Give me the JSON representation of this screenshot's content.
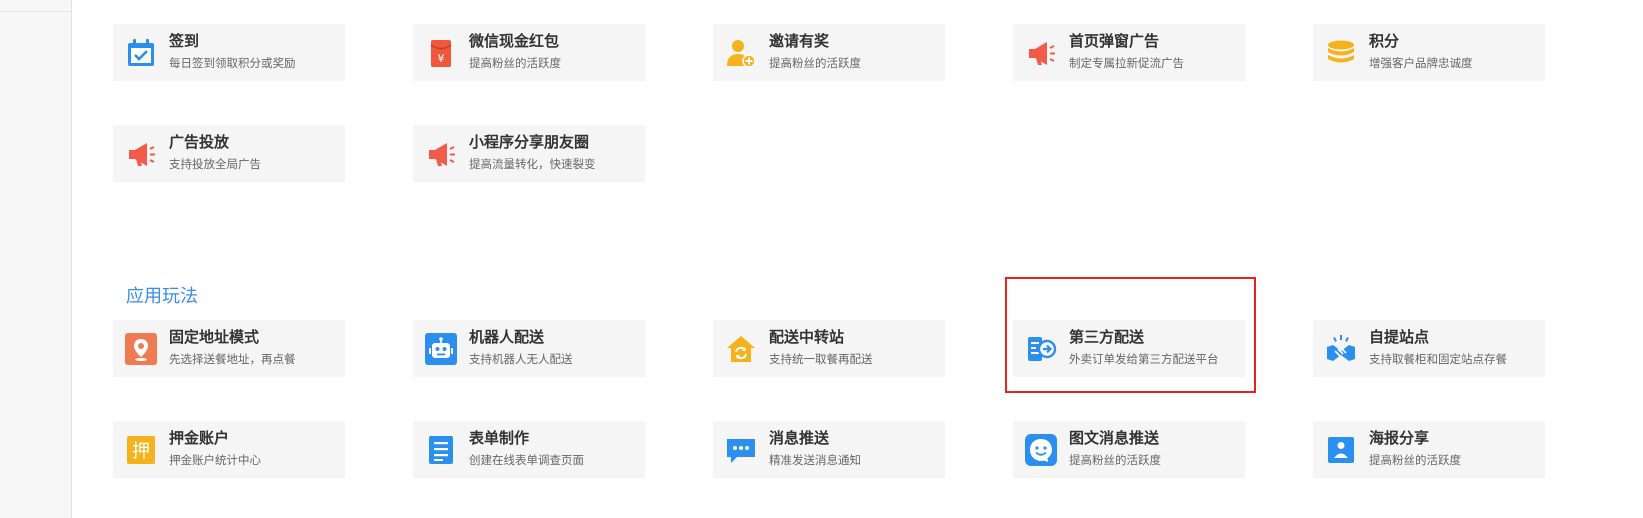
{
  "section": {
    "title": "应用玩法"
  },
  "top_cards": [
    {
      "title": "签到",
      "desc": "每日签到领取积分或奖励",
      "icon": "calendar-check-icon"
    },
    {
      "title": "微信现金红包",
      "desc": "提高粉丝的活跃度",
      "icon": "red-envelope-icon"
    },
    {
      "title": "邀请有奖",
      "desc": "提高粉丝的活跃度",
      "icon": "invite-user-icon"
    },
    {
      "title": "首页弹窗广告",
      "desc": "制定专属拉新促流广告",
      "icon": "megaphone-icon"
    },
    {
      "title": "积分",
      "desc": "增强客户品牌忠诚度",
      "icon": "coin-stack-icon"
    },
    {
      "title": "广告投放",
      "desc": "支持投放全局广告",
      "icon": "megaphone-icon"
    },
    {
      "title": "小程序分享朋友圈",
      "desc": "提高流量转化，快速裂变",
      "icon": "megaphone-icon"
    }
  ],
  "app_cards": [
    {
      "title": "固定地址模式",
      "desc": "先选择送餐地址，再点餐",
      "icon": "map-pin-icon"
    },
    {
      "title": "机器人配送",
      "desc": "支持机器人无人配送",
      "icon": "robot-icon"
    },
    {
      "title": "配送中转站",
      "desc": "支持统一取餐再配送",
      "icon": "transfer-house-icon"
    },
    {
      "title": "第三方配送",
      "desc": "外卖订单发给第三方配送平台",
      "icon": "third-party-delivery-icon"
    },
    {
      "title": "自提站点",
      "desc": "支持取餐柜和固定站点存餐",
      "icon": "handshake-icon"
    },
    {
      "title": "押金账户",
      "desc": "押金账户统计中心",
      "icon": "deposit-icon"
    },
    {
      "title": "表单制作",
      "desc": "创建在线表单调查页面",
      "icon": "form-list-icon"
    },
    {
      "title": "消息推送",
      "desc": "精准发送消息通知",
      "icon": "chat-bubble-icon"
    },
    {
      "title": "图文消息推送",
      "desc": "提高粉丝的活跃度",
      "icon": "smiley-message-icon"
    },
    {
      "title": "海报分享",
      "desc": "提高粉丝的活跃度",
      "icon": "poster-image-icon"
    }
  ],
  "icon_glyphs": {
    "red_envelope": "¥",
    "deposit": "押"
  },
  "colors": {
    "accent_blue": "#3a8ee6",
    "highlight_red": "#e8231e",
    "icon_blue": "#2b8ff0",
    "icon_red": "#f25a4a",
    "icon_yellow": "#f6b21c",
    "icon_orange": "#f07a52"
  }
}
